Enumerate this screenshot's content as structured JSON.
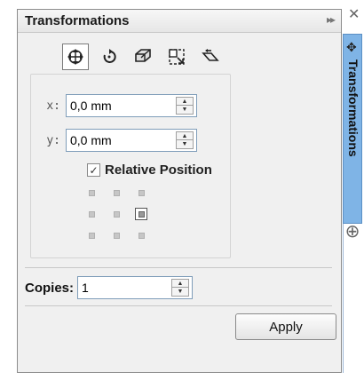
{
  "panel": {
    "title": "Transformations",
    "collapse_glyph": "▸▸"
  },
  "window": {
    "close_glyph": "✕"
  },
  "toolbar": {
    "tools": [
      {
        "icon": "move-icon",
        "active": true
      },
      {
        "icon": "rotate-icon",
        "active": false
      },
      {
        "icon": "scale-mirror-icon",
        "active": false
      },
      {
        "icon": "size-icon",
        "active": false
      },
      {
        "icon": "skew-icon",
        "active": false
      }
    ]
  },
  "position": {
    "x_label": "x:",
    "x_value": "0,0 mm",
    "y_label": "y:",
    "y_value": "0,0 mm",
    "relative_label": "Relative Position",
    "relative_checked": true,
    "anchor_selected": "middle-right"
  },
  "copies": {
    "label": "Copies:",
    "value": "1"
  },
  "apply_label": "Apply",
  "side_tab": {
    "label": "Transformations",
    "add_glyph": "⊕"
  },
  "colors": {
    "side_tab_bg": "#7fb4e6",
    "field_border": "#7f9db9"
  }
}
